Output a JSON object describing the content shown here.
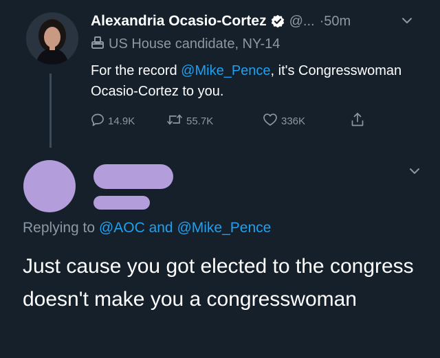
{
  "tweet": {
    "author_name": "Alexandria Ocasio-Cortez",
    "handle": "@...",
    "time": "·50m",
    "label": "US House candidate, NY-14",
    "text_prefix": "For the record ",
    "mention": "@Mike_Pence",
    "text_suffix": ", it's Congresswoman Ocasio-Cortez to you.",
    "actions": {
      "replies": "14.9K",
      "retweets": "55.7K",
      "likes": "336K"
    }
  },
  "reply": {
    "replying_prefix": "Replying to ",
    "replying_to_1": "@AOC",
    "replying_and": " and ",
    "replying_to_2": "@Mike_Pence",
    "text": "Just cause you got elected to the congress doesn't make you a congresswoman"
  },
  "colors": {
    "background": "#15202b",
    "link": "#1da1f2",
    "muted": "#8b98a5",
    "redaction": "#b39ddb"
  },
  "icons": [
    "verified-badge-icon",
    "chevron-down-icon",
    "ballot-box-icon",
    "reply-icon",
    "retweet-icon",
    "like-icon",
    "share-icon"
  ]
}
